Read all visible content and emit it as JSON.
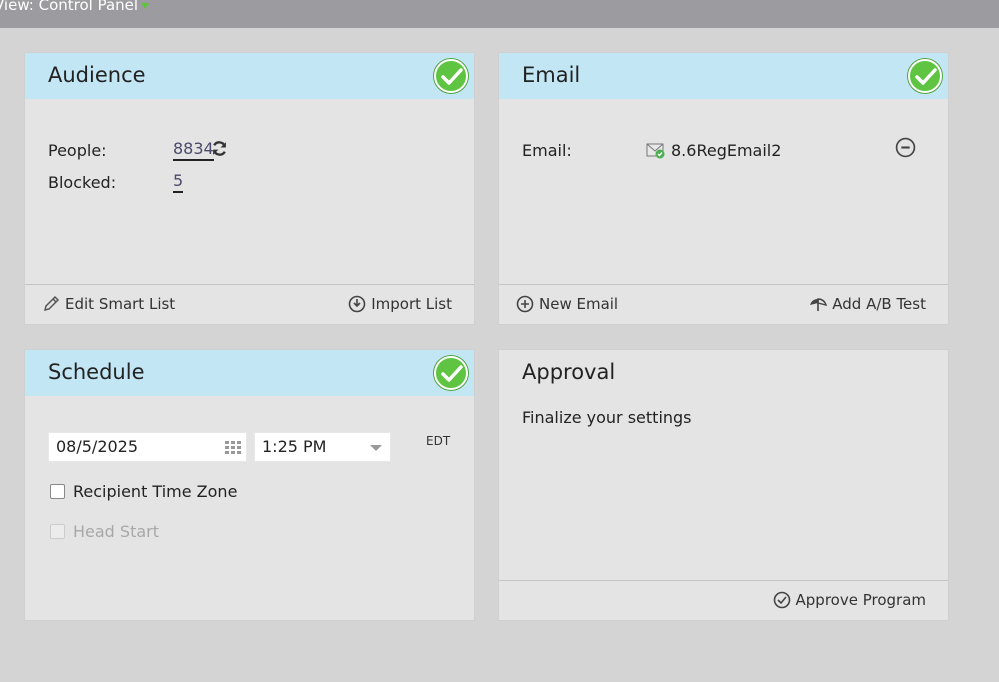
{
  "topbar": {
    "title": "View: Control Panel"
  },
  "audience": {
    "title": "Audience",
    "people_label": "People:",
    "people_value": "8834",
    "blocked_label": "Blocked:",
    "blocked_value": "5",
    "edit_smart_list": "Edit Smart List",
    "import_list": "Import List"
  },
  "email": {
    "title": "Email",
    "email_label": "Email:",
    "email_value": "8.6RegEmail2",
    "new_email": "New Email",
    "add_ab_test": "Add A/B Test"
  },
  "schedule": {
    "title": "Schedule",
    "date_value": "08/5/2025",
    "time_value": "1:25 PM",
    "timezone": "EDT",
    "recipient_time_zone": "Recipient Time Zone",
    "head_start": "Head Start"
  },
  "approval": {
    "title": "Approval",
    "message": "Finalize your settings",
    "approve_program": "Approve Program"
  },
  "colors": {
    "header_blue": "#c3e6f5",
    "check_green": "#5ec442",
    "panel_bg": "#e4e4e4"
  }
}
